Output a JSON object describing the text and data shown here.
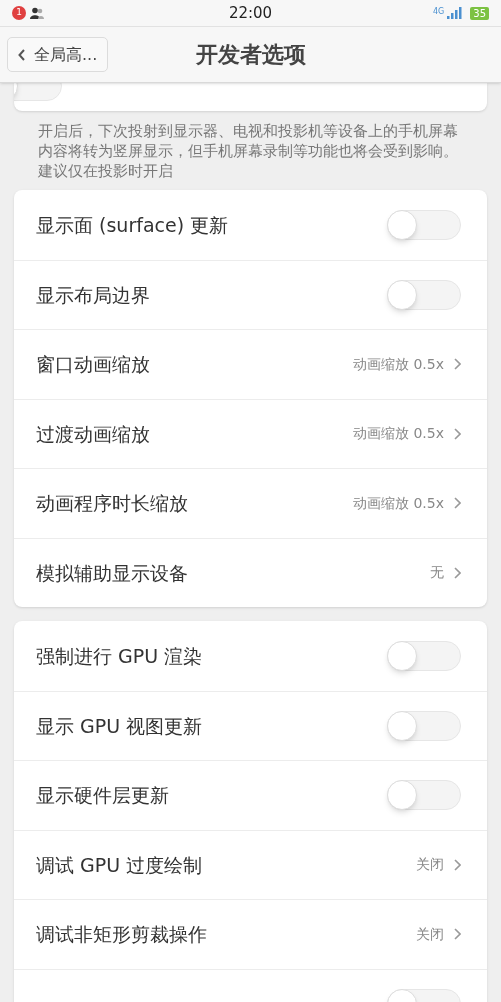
{
  "status_bar": {
    "notification_count": "1",
    "time": "22:00",
    "network": "4G",
    "battery": "35"
  },
  "nav": {
    "back_label": "全局高...",
    "title": "开发者选项"
  },
  "top_card": {
    "kind": "toggle",
    "on": false
  },
  "description": "开启后，下次投射到显示器、电视和投影机等设备上的手机屏幕内容将转为竖屏显示，但手机屏幕录制等功能也将会受到影响。建议仅在投影时开启",
  "groups": [
    {
      "rows": [
        {
          "kind": "toggle",
          "label": "显示面 (surface) 更新",
          "on": false
        },
        {
          "kind": "toggle",
          "label": "显示布局边界",
          "on": false
        },
        {
          "kind": "value",
          "label": "窗口动画缩放",
          "value": "动画缩放 0.5x"
        },
        {
          "kind": "value",
          "label": "过渡动画缩放",
          "value": "动画缩放 0.5x"
        },
        {
          "kind": "value",
          "label": "动画程序时长缩放",
          "value": "动画缩放 0.5x"
        },
        {
          "kind": "value",
          "label": "模拟辅助显示设备",
          "value": "无"
        }
      ]
    },
    {
      "rows": [
        {
          "kind": "toggle",
          "label": "强制进行 GPU 渲染",
          "on": false
        },
        {
          "kind": "toggle",
          "label": "显示 GPU 视图更新",
          "on": false
        },
        {
          "kind": "toggle",
          "label": "显示硬件层更新",
          "on": false
        },
        {
          "kind": "value",
          "label": "调试 GPU 过度绘制",
          "value": "关闭"
        },
        {
          "kind": "value",
          "label": "调试非矩形剪裁操作",
          "value": "关闭"
        },
        {
          "kind": "toggle",
          "on": false
        }
      ]
    }
  ]
}
